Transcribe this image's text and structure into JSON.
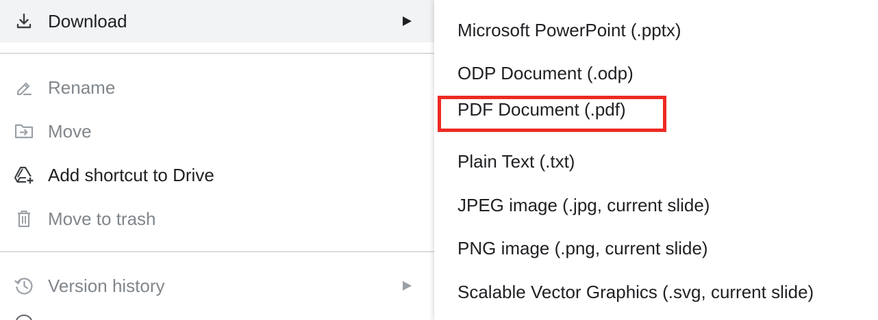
{
  "file_menu": {
    "download": {
      "label": "Download",
      "icon": "download-icon",
      "state": "hovered"
    },
    "rename": {
      "label": "Rename",
      "icon": "rename-icon",
      "state": "disabled"
    },
    "move": {
      "label": "Move",
      "icon": "move-folder-icon",
      "state": "disabled"
    },
    "add_shortcut": {
      "label": "Add shortcut to Drive",
      "icon": "add-shortcut-drive-icon",
      "state": "enabled"
    },
    "trash": {
      "label": "Move to trash",
      "icon": "trash-icon",
      "state": "disabled"
    },
    "version_history": {
      "label": "Version history",
      "icon": "history-icon",
      "state": "disabled"
    }
  },
  "download_submenu": {
    "items": [
      {
        "label": "Microsoft PowerPoint (.pptx)"
      },
      {
        "label": "ODP Document (.odp)"
      },
      {
        "label": "PDF Document (.pdf)",
        "highlighted": true
      },
      {
        "label": "Plain Text (.txt)"
      },
      {
        "label": "JPEG image (.jpg, current slide)"
      },
      {
        "label": "PNG image (.png, current slide)"
      },
      {
        "label": "Scalable Vector Graphics (.svg, current slide)"
      }
    ]
  },
  "colors": {
    "hover_background": "#f1f3f4",
    "text": "#202124",
    "disabled_text": "#80868b",
    "divider": "#dadce0",
    "highlight_outline": "#ee2a22"
  }
}
